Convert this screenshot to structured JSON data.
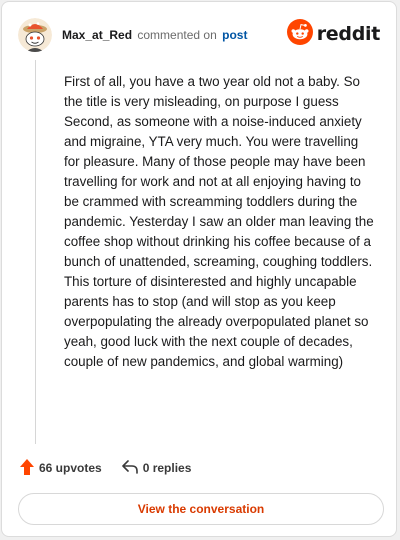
{
  "header": {
    "username": "Max_at_Red",
    "action": "commented on",
    "post_link": "post",
    "brand_word": "reddit"
  },
  "comment": {
    "body": "First of all, you have a two year old not a baby. So the title is very misleading, on purpose I guess Second, as someone with a noise-induced anxiety and migraine, YTA very much. You were travelling for pleasure. Many of those people may have been travelling for work and not at all enjoying having to be crammed with screamming toddlers during the pandemic. Yesterday I saw an older man leaving the coffee shop without drinking his coffee because of a bunch of unattended, screaming, coughing toddlers. This torture of disinterested and highly uncapable parents has to stop (and will stop as you keep overpopulating the already overpopulated planet so yeah, good luck with the next couple of decades, couple of new pandemics, and global warming)"
  },
  "actions": {
    "upvotes": "66 upvotes",
    "replies": "0 replies"
  },
  "footer": {
    "view_button": "View the conversation"
  },
  "icons": {
    "avatar": "snoo-avatar-icon",
    "brand": "reddit-logo-icon",
    "upvote": "upvote-arrow-icon",
    "reply": "reply-arrow-icon"
  },
  "colors": {
    "brand_orange": "#ff4500",
    "link_blue": "#0055a4",
    "button_text": "#d93a00"
  }
}
